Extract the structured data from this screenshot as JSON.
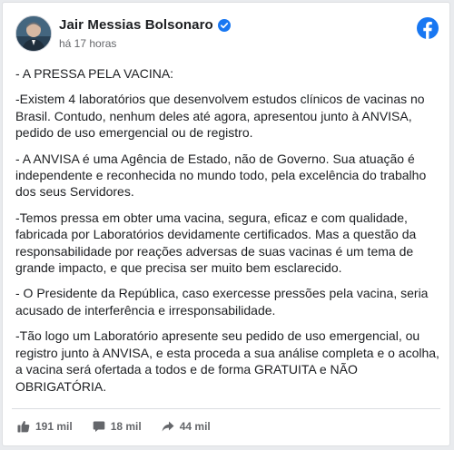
{
  "post": {
    "author": "Jair Messias Bolsonaro",
    "timestamp": "há 17 horas",
    "verified_icon": "verified-badge-icon",
    "platform_icon": "facebook-logo-icon",
    "brand_color": "#1877f2",
    "paragraphs": [
      "- A PRESSA PELA VACINA:",
      "-Existem 4 laboratórios que desenvolvem estudos clínicos de vacinas no Brasil. Contudo, nenhum deles até agora, apresentou junto à ANVISA, pedido de uso emergencial ou de registro.",
      "- A ANVISA é uma Agência de Estado, não de Governo. Sua atuação é independente e reconhecida no mundo todo, pela excelência do trabalho dos seus Servidores.",
      "-Temos pressa em obter uma vacina, segura, eficaz e com qualidade, fabricada por Laboratórios devidamente certificados. Mas a questão da responsabilidade por reações adversas de suas vacinas é um tema de grande impacto, e que precisa ser muito bem esclarecido.",
      "- O Presidente da República, caso exercesse pressões pela vacina, seria acusado de interferência e irresponsabilidade.",
      "-Tão logo um Laboratório apresente seu pedido de uso emergencial, ou registro junto à ANVISA, e esta proceda a sua análise completa e o acolha, a vacina será ofertada a todos e de forma GRATUITA e NÃO OBRIGATÓRIA."
    ]
  },
  "stats": {
    "likes": "191 mil",
    "comments": "18 mil",
    "shares": "44 mil"
  }
}
